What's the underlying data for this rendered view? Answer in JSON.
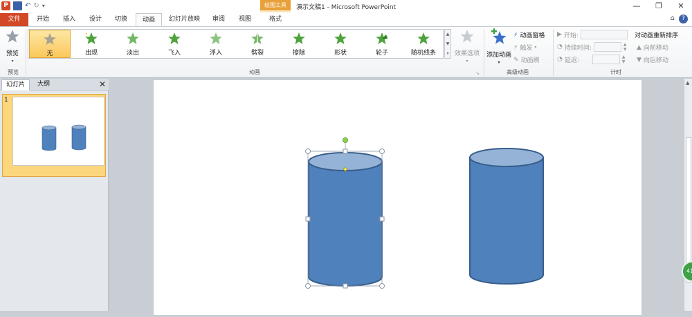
{
  "window": {
    "title": "演示文稿1 - Microsoft PowerPoint",
    "context_tool": "绘图工具"
  },
  "tabs": [
    {
      "label": "文件"
    },
    {
      "label": "开始"
    },
    {
      "label": "插入"
    },
    {
      "label": "设计"
    },
    {
      "label": "切换"
    },
    {
      "label": "动画"
    },
    {
      "label": "幻灯片放映"
    },
    {
      "label": "审阅"
    },
    {
      "label": "视图"
    },
    {
      "label": "格式"
    }
  ],
  "ribbon": {
    "preview": {
      "label": "预览",
      "group": "预览"
    },
    "animation_group": "动画",
    "gallery": [
      {
        "label": "无",
        "selected": true
      },
      {
        "label": "出现"
      },
      {
        "label": "淡出"
      },
      {
        "label": "飞入"
      },
      {
        "label": "浮入"
      },
      {
        "label": "劈裂"
      },
      {
        "label": "擦除"
      },
      {
        "label": "形状"
      },
      {
        "label": "轮子"
      },
      {
        "label": "随机线条"
      }
    ],
    "effect_options": "效果选项",
    "advanced": {
      "group": "高级动画",
      "add_animation": "添加动画",
      "animation_pane": "动画窗格",
      "trigger": "触发",
      "animation_painter": "动画刷"
    },
    "timing": {
      "group": "计时",
      "start": "开始:",
      "duration": "持续时间:",
      "delay": "延迟:",
      "reorder_title": "对动画重新排序",
      "move_earlier": "向前移动",
      "move_later": "向后移动"
    }
  },
  "left_panel": {
    "tab_slides": "幻灯片",
    "tab_outline": "大纲",
    "slide_number": "1"
  },
  "colors": {
    "accent": "#d24726",
    "shape_fill": "#4f81bd",
    "shape_top": "#95b3d7",
    "shape_stroke": "#385d8a",
    "star_green": "#4fa33d"
  }
}
